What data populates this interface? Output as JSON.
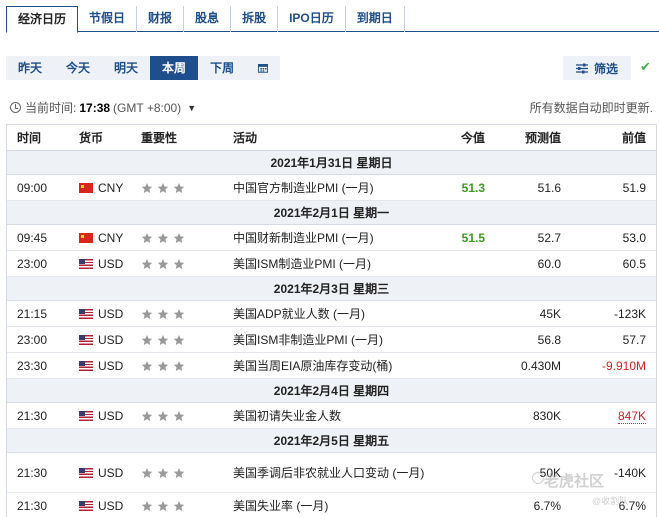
{
  "top_tabs": [
    "经济日历",
    "节假日",
    "财报",
    "股息",
    "拆股",
    "IPO日历",
    "到期日"
  ],
  "day_tabs": [
    "昨天",
    "今天",
    "明天",
    "本周",
    "下周"
  ],
  "filter_label": "筛选",
  "time_prefix": "当前时间:",
  "current_time": "17:38",
  "timezone": "(GMT +8:00)",
  "autoupdate": "所有数据自动即时更新.",
  "headers": {
    "time": "时间",
    "currency": "货币",
    "importance": "重要性",
    "activity": "活动",
    "actual": "今值",
    "forecast": "预测值",
    "previous": "前值"
  },
  "dates": [
    "2021年1月31日 星期日",
    "2021年2月1日 星期一",
    "2021年2月3日 星期三",
    "2021年2月4日 星期四",
    "2021年2月5日 星期五"
  ],
  "events": [
    {
      "time": "09:00",
      "currency": "CNY",
      "activity": "中国官方制造业PMI (一月)",
      "actual": "51.3",
      "forecast": "51.6",
      "previous": "51.9"
    },
    {
      "time": "09:45",
      "currency": "CNY",
      "activity": "中国财新制造业PMI (一月)",
      "actual": "51.5",
      "forecast": "52.7",
      "previous": "53.0"
    },
    {
      "time": "23:00",
      "currency": "USD",
      "activity": "美国ISM制造业PMI (一月)",
      "actual": "",
      "forecast": "60.0",
      "previous": "60.5"
    },
    {
      "time": "21:15",
      "currency": "USD",
      "activity": "美国ADP就业人数 (一月)",
      "actual": "",
      "forecast": "45K",
      "previous": "-123K"
    },
    {
      "time": "23:00",
      "currency": "USD",
      "activity": "美国ISM非制造业PMI (一月)",
      "actual": "",
      "forecast": "56.8",
      "previous": "57.7"
    },
    {
      "time": "23:30",
      "currency": "USD",
      "activity": "美国当周EIA原油库存变动(桶)",
      "actual": "",
      "forecast": "0.430M",
      "previous": "-9.910M"
    },
    {
      "time": "21:30",
      "currency": "USD",
      "activity": "美国初请失业金人数",
      "actual": "",
      "forecast": "830K",
      "previous": "847K"
    },
    {
      "time": "21:30",
      "currency": "USD",
      "activity": "美国季调后非农就业人口变动 (一月)",
      "actual": "",
      "forecast": "50K",
      "previous": "-140K"
    },
    {
      "time": "21:30",
      "currency": "USD",
      "activity": "美国失业率 (一月)",
      "actual": "",
      "forecast": "6.7%",
      "previous": "6.7%"
    }
  ],
  "importance_stars": 3,
  "colors": {
    "accent": "#1f4e8c",
    "positive": "#3a9b1e",
    "negative": "#d21f1f",
    "star": "#9a9a9a"
  },
  "watermark": {
    "line1": "老虎社区",
    "line2": "@收割队"
  }
}
